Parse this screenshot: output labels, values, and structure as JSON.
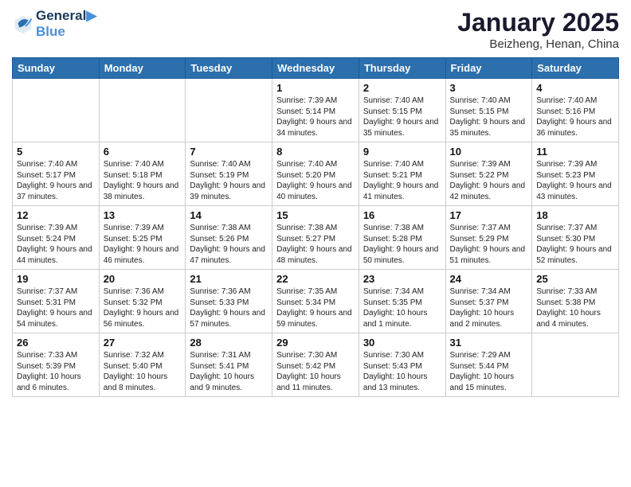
{
  "header": {
    "logo_line1": "General",
    "logo_line2": "Blue",
    "month_title": "January 2025",
    "location": "Beizheng, Henan, China"
  },
  "days_of_week": [
    "Sunday",
    "Monday",
    "Tuesday",
    "Wednesday",
    "Thursday",
    "Friday",
    "Saturday"
  ],
  "weeks": [
    [
      {
        "day": "",
        "text": "",
        "empty": true
      },
      {
        "day": "",
        "text": "",
        "empty": true
      },
      {
        "day": "",
        "text": "",
        "empty": true
      },
      {
        "day": "1",
        "text": "Sunrise: 7:39 AM\nSunset: 5:14 PM\nDaylight: 9 hours and 34 minutes.",
        "empty": false
      },
      {
        "day": "2",
        "text": "Sunrise: 7:40 AM\nSunset: 5:15 PM\nDaylight: 9 hours and 35 minutes.",
        "empty": false
      },
      {
        "day": "3",
        "text": "Sunrise: 7:40 AM\nSunset: 5:15 PM\nDaylight: 9 hours and 35 minutes.",
        "empty": false
      },
      {
        "day": "4",
        "text": "Sunrise: 7:40 AM\nSunset: 5:16 PM\nDaylight: 9 hours and 36 minutes.",
        "empty": false
      }
    ],
    [
      {
        "day": "5",
        "text": "Sunrise: 7:40 AM\nSunset: 5:17 PM\nDaylight: 9 hours and 37 minutes.",
        "empty": false
      },
      {
        "day": "6",
        "text": "Sunrise: 7:40 AM\nSunset: 5:18 PM\nDaylight: 9 hours and 38 minutes.",
        "empty": false
      },
      {
        "day": "7",
        "text": "Sunrise: 7:40 AM\nSunset: 5:19 PM\nDaylight: 9 hours and 39 minutes.",
        "empty": false
      },
      {
        "day": "8",
        "text": "Sunrise: 7:40 AM\nSunset: 5:20 PM\nDaylight: 9 hours and 40 minutes.",
        "empty": false
      },
      {
        "day": "9",
        "text": "Sunrise: 7:40 AM\nSunset: 5:21 PM\nDaylight: 9 hours and 41 minutes.",
        "empty": false
      },
      {
        "day": "10",
        "text": "Sunrise: 7:39 AM\nSunset: 5:22 PM\nDaylight: 9 hours and 42 minutes.",
        "empty": false
      },
      {
        "day": "11",
        "text": "Sunrise: 7:39 AM\nSunset: 5:23 PM\nDaylight: 9 hours and 43 minutes.",
        "empty": false
      }
    ],
    [
      {
        "day": "12",
        "text": "Sunrise: 7:39 AM\nSunset: 5:24 PM\nDaylight: 9 hours and 44 minutes.",
        "empty": false
      },
      {
        "day": "13",
        "text": "Sunrise: 7:39 AM\nSunset: 5:25 PM\nDaylight: 9 hours and 46 minutes.",
        "empty": false
      },
      {
        "day": "14",
        "text": "Sunrise: 7:38 AM\nSunset: 5:26 PM\nDaylight: 9 hours and 47 minutes.",
        "empty": false
      },
      {
        "day": "15",
        "text": "Sunrise: 7:38 AM\nSunset: 5:27 PM\nDaylight: 9 hours and 48 minutes.",
        "empty": false
      },
      {
        "day": "16",
        "text": "Sunrise: 7:38 AM\nSunset: 5:28 PM\nDaylight: 9 hours and 50 minutes.",
        "empty": false
      },
      {
        "day": "17",
        "text": "Sunrise: 7:37 AM\nSunset: 5:29 PM\nDaylight: 9 hours and 51 minutes.",
        "empty": false
      },
      {
        "day": "18",
        "text": "Sunrise: 7:37 AM\nSunset: 5:30 PM\nDaylight: 9 hours and 52 minutes.",
        "empty": false
      }
    ],
    [
      {
        "day": "19",
        "text": "Sunrise: 7:37 AM\nSunset: 5:31 PM\nDaylight: 9 hours and 54 minutes.",
        "empty": false
      },
      {
        "day": "20",
        "text": "Sunrise: 7:36 AM\nSunset: 5:32 PM\nDaylight: 9 hours and 56 minutes.",
        "empty": false
      },
      {
        "day": "21",
        "text": "Sunrise: 7:36 AM\nSunset: 5:33 PM\nDaylight: 9 hours and 57 minutes.",
        "empty": false
      },
      {
        "day": "22",
        "text": "Sunrise: 7:35 AM\nSunset: 5:34 PM\nDaylight: 9 hours and 59 minutes.",
        "empty": false
      },
      {
        "day": "23",
        "text": "Sunrise: 7:34 AM\nSunset: 5:35 PM\nDaylight: 10 hours and 1 minute.",
        "empty": false
      },
      {
        "day": "24",
        "text": "Sunrise: 7:34 AM\nSunset: 5:37 PM\nDaylight: 10 hours and 2 minutes.",
        "empty": false
      },
      {
        "day": "25",
        "text": "Sunrise: 7:33 AM\nSunset: 5:38 PM\nDaylight: 10 hours and 4 minutes.",
        "empty": false
      }
    ],
    [
      {
        "day": "26",
        "text": "Sunrise: 7:33 AM\nSunset: 5:39 PM\nDaylight: 10 hours and 6 minutes.",
        "empty": false
      },
      {
        "day": "27",
        "text": "Sunrise: 7:32 AM\nSunset: 5:40 PM\nDaylight: 10 hours and 8 minutes.",
        "empty": false
      },
      {
        "day": "28",
        "text": "Sunrise: 7:31 AM\nSunset: 5:41 PM\nDaylight: 10 hours and 9 minutes.",
        "empty": false
      },
      {
        "day": "29",
        "text": "Sunrise: 7:30 AM\nSunset: 5:42 PM\nDaylight: 10 hours and 11 minutes.",
        "empty": false
      },
      {
        "day": "30",
        "text": "Sunrise: 7:30 AM\nSunset: 5:43 PM\nDaylight: 10 hours and 13 minutes.",
        "empty": false
      },
      {
        "day": "31",
        "text": "Sunrise: 7:29 AM\nSunset: 5:44 PM\nDaylight: 10 hours and 15 minutes.",
        "empty": false
      },
      {
        "day": "",
        "text": "",
        "empty": true
      }
    ]
  ]
}
